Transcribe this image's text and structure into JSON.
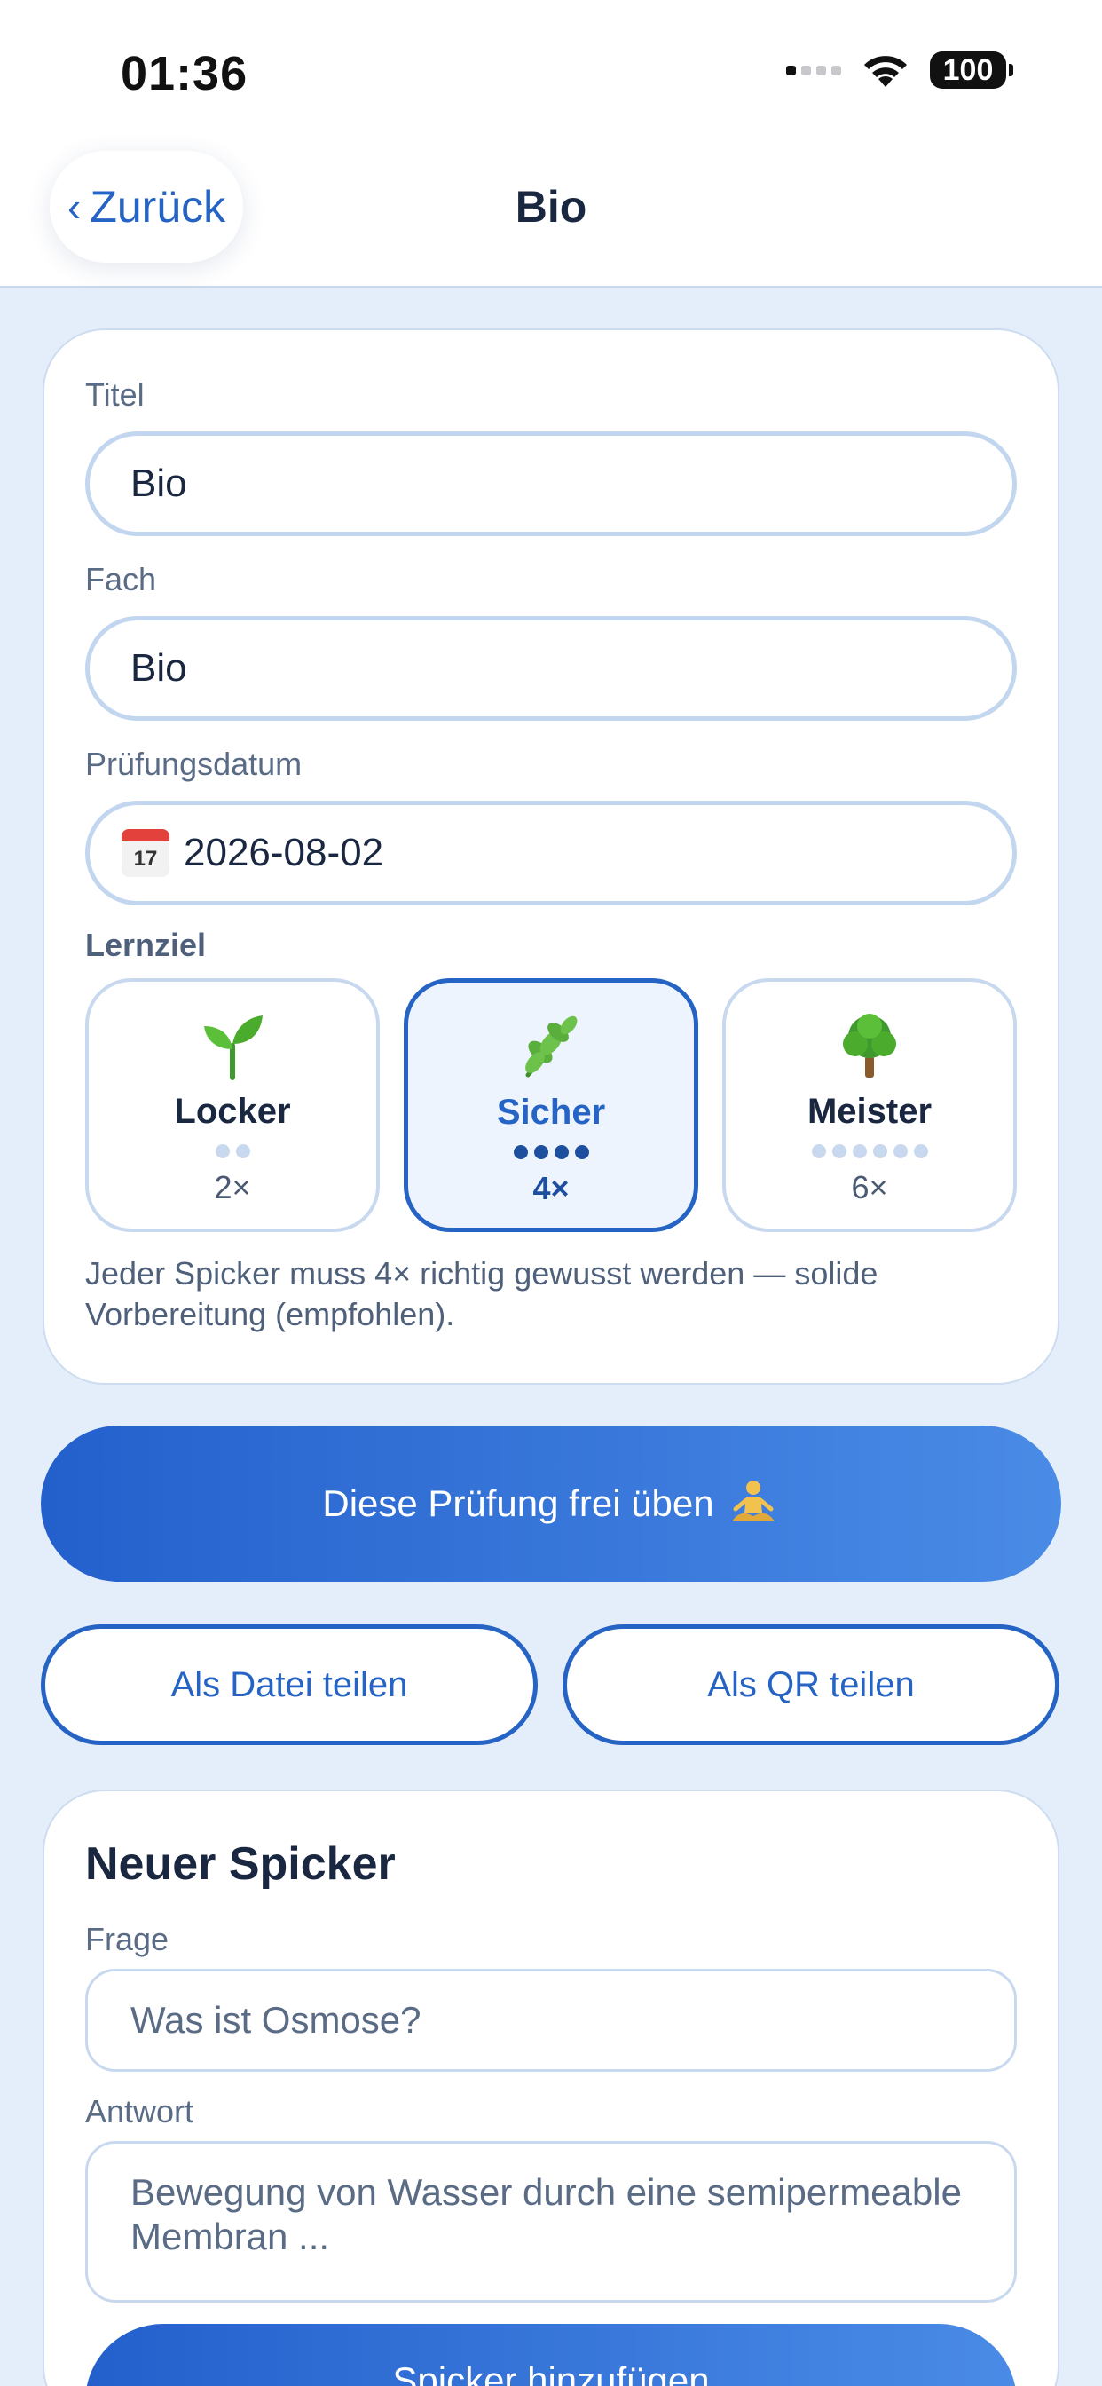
{
  "status": {
    "time": "01:36",
    "battery": "100"
  },
  "nav": {
    "back_label": "Zurück",
    "title": "Bio"
  },
  "form": {
    "title_label": "Titel",
    "title_value": "Bio",
    "subject_label": "Fach",
    "subject_value": "Bio",
    "date_label": "Prüfungsdatum",
    "date_icon_day": "17",
    "date_value": "2026-08-02",
    "goal_label": "Lernziel",
    "goals": [
      {
        "name": "Locker",
        "count": "2×",
        "dots": 2,
        "icon": "seedling-icon"
      },
      {
        "name": "Sicher",
        "count": "4×",
        "dots": 4,
        "icon": "herb-icon",
        "selected": true
      },
      {
        "name": "Meister",
        "count": "6×",
        "dots": 6,
        "icon": "tree-icon"
      }
    ],
    "goal_description": "Jeder Spicker muss 4× richtig gewusst werden — solide Vorbereitung (empfohlen)."
  },
  "actions": {
    "practice_label": "Diese Prüfung frei üben",
    "share_file_label": "Als Datei teilen",
    "share_qr_label": "Als QR teilen"
  },
  "new_card": {
    "heading": "Neuer Spicker",
    "question_label": "Frage",
    "question_placeholder": "Was ist Osmose?",
    "answer_label": "Antwort",
    "answer_placeholder": "Bewegung von Wasser durch eine semipermeable Membran ...",
    "submit_label": "Spicker hinzufügen"
  },
  "colors": {
    "accent": "#2563c4",
    "background": "#e4eefb",
    "border": "#c3d6ef"
  }
}
